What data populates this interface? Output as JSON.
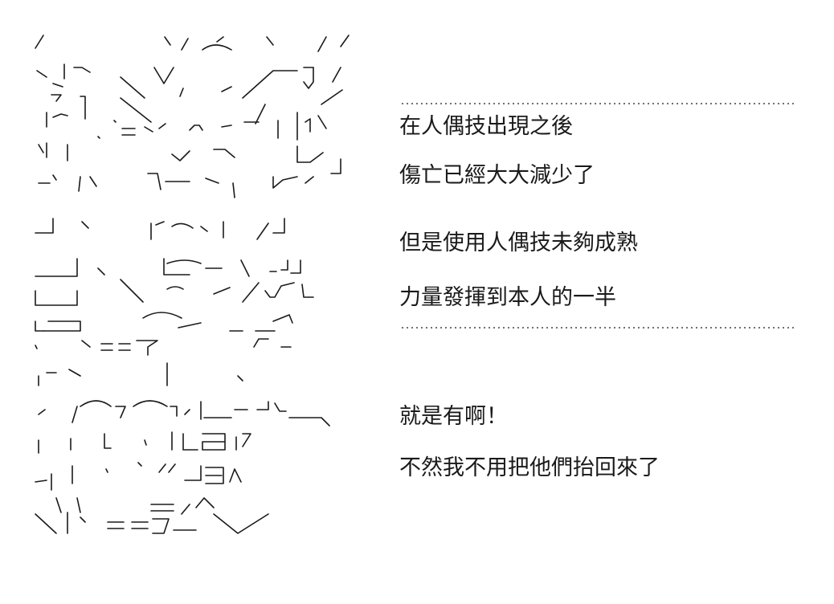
{
  "dialogue": {
    "block1": [
      "在人偶技出現之後",
      "傷亡已經大大減少了",
      "但是使用人偶技未夠成熟",
      "力量發揮到本人的一半"
    ],
    "block2": [
      "就是有啊！",
      "不然我不用把他們抬回來了"
    ]
  },
  "art": {
    "description_icon": "ascii-art-character"
  }
}
